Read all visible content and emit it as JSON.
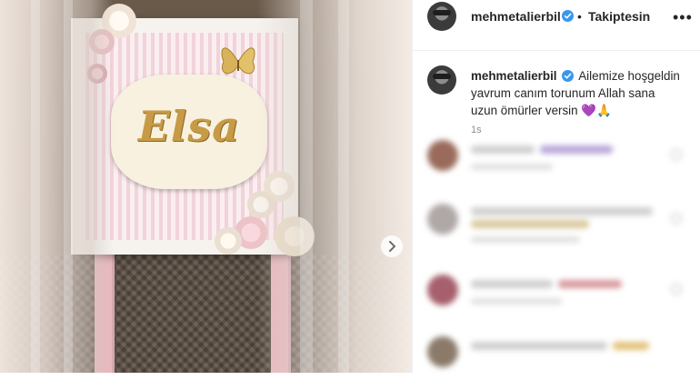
{
  "post": {
    "username": "mehmetalierbil",
    "separator": "•",
    "follow_state": "Takiptesin",
    "more_icon": "•••",
    "caption": {
      "username": "mehmetalierbil",
      "line1": "Ailemize hoşgeldin",
      "line2": "yavrum canım torunum Allah sana",
      "line3": "uzun ömürler versin",
      "emojis": "💜🙏"
    },
    "timestamp": "1s"
  },
  "photo": {
    "plaque_text": "Elsa",
    "next_icon": "›"
  },
  "colors": {
    "verified_blue": "#3897f0",
    "text_primary": "#262626",
    "text_secondary": "#8e8e8e",
    "frame_pink": "#f1d3da",
    "plaque_gold": "#c79a45"
  }
}
